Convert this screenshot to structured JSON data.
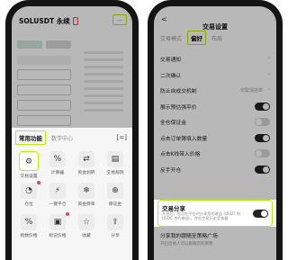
{
  "left": {
    "pair": "SOLUSDT 永续",
    "badge": "-",
    "more_button": "...",
    "sheet": {
      "tab_active": "常用功能",
      "tab_other": "数学中心",
      "tab_icon": "[=]"
    },
    "features": [
      {
        "label": "交易设置",
        "icon": "⚙",
        "highlight": true,
        "dot": false
      },
      {
        "label": "计算器",
        "icon": "%",
        "highlight": false,
        "dot": false
      },
      {
        "label": "资金划转",
        "icon": "⇄",
        "highlight": false,
        "dot": false
      },
      {
        "label": "交易规则",
        "icon": "▤",
        "highlight": false,
        "dot": false
      },
      {
        "label": "仓位",
        "icon": "◔",
        "highlight": false,
        "dot": true
      },
      {
        "label": "一键平仓",
        "icon": "⚡",
        "highlight": false,
        "dot": false
      },
      {
        "label": "资金费率",
        "icon": "❄",
        "highlight": false,
        "dot": false
      },
      {
        "label": "保证金",
        "icon": "⊕",
        "highlight": false,
        "dot": false
      },
      {
        "label": "指数价格",
        "icon": "%",
        "highlight": false,
        "dot": false
      },
      {
        "label": "标记价格",
        "icon": "▣",
        "highlight": false,
        "dot": true
      },
      {
        "label": "收藏",
        "icon": "☆",
        "highlight": false,
        "dot": false
      },
      {
        "label": "分享",
        "icon": "⇪",
        "highlight": false,
        "dot": false
      }
    ]
  },
  "right": {
    "title": "交易设置",
    "back": "<",
    "tabs": {
      "first": "交易模式",
      "active": "偏好",
      "last": "布局"
    },
    "items": [
      {
        "label": "交易通知",
        "type": "chevron",
        "value": ""
      },
      {
        "label": "二次确认",
        "type": "chevron",
        "value": ""
      },
      {
        "label": "防止自成交机制",
        "type": "chevron",
        "value": "仅取消挂单"
      },
      {
        "label": "展示预估强平价",
        "type": "toggle",
        "on": true
      },
      {
        "label": "全仓保证金",
        "type": "toggle",
        "on": false
      },
      {
        "label": "点击订单簿填入数量",
        "type": "toggle",
        "on": true
      },
      {
        "label": "点击K线带入价格",
        "type": "toggle",
        "on": false
      },
      {
        "label": "反手开仓",
        "type": "toggle",
        "on": true
      }
    ],
    "share": {
      "title": "交易分享",
      "desc": "开启后，您可在平仓时分享您的收益 (USDT 和USDC 合约收益)，并在交易历史里查看",
      "on": true
    },
    "bottom": {
      "label": "分享我的跟随至策略广场",
      "sub": "开启后他人可以跟随您的策略"
    }
  }
}
